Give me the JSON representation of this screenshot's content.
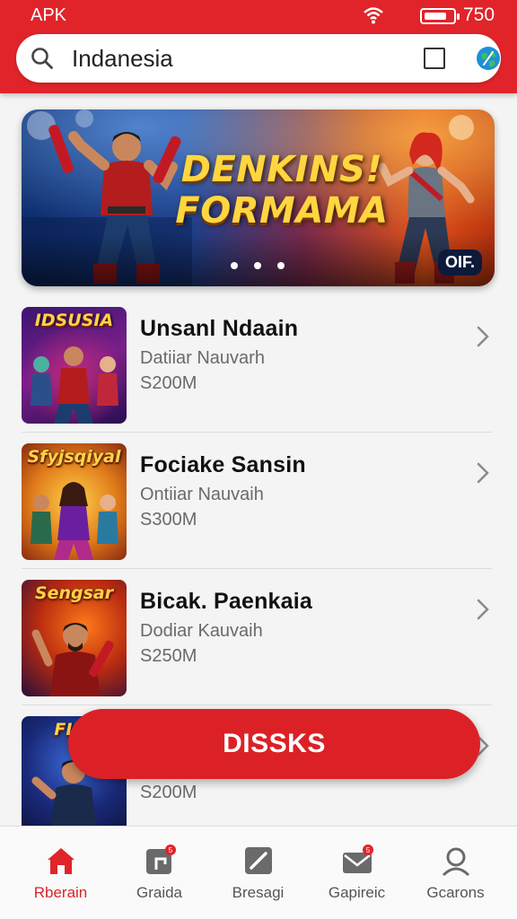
{
  "status_bar": {
    "carrier": "APK",
    "time": "750"
  },
  "search": {
    "value": "Indanesia"
  },
  "banner": {
    "title_line1": "DENKINS!",
    "title_line2": "FORMAMA",
    "badge": "OIF."
  },
  "list": [
    {
      "thumb_title": "IDSUSIA",
      "name": "Unsanl Ndaain",
      "sub": "Datiiar Nauvarh",
      "price": "S200M"
    },
    {
      "thumb_title": "Sfyjsqiyal",
      "name": "Fociake Sansin",
      "sub": "Ontiiar Nauvaih",
      "price": "S300M"
    },
    {
      "thumb_title": "Sengsar",
      "name": "Bicak. Paenkaia",
      "sub": "Dodiar Kauvaih",
      "price": "S250M"
    },
    {
      "thumb_title": "FLIL",
      "name": "",
      "sub": "",
      "price": "S200M"
    }
  ],
  "cta": {
    "label": "DISSKS"
  },
  "nav": [
    {
      "label": "Rberain",
      "icon": "home-icon",
      "active": true
    },
    {
      "label": "Graida",
      "icon": "grid-icon"
    },
    {
      "label": "Bresagi",
      "icon": "edit-icon"
    },
    {
      "label": "Gapireic",
      "icon": "mail-icon"
    },
    {
      "label": "Gcarons",
      "icon": "profile-icon"
    }
  ],
  "colors": {
    "primary_red": "#e0242a",
    "background": "#f4f4f4"
  }
}
